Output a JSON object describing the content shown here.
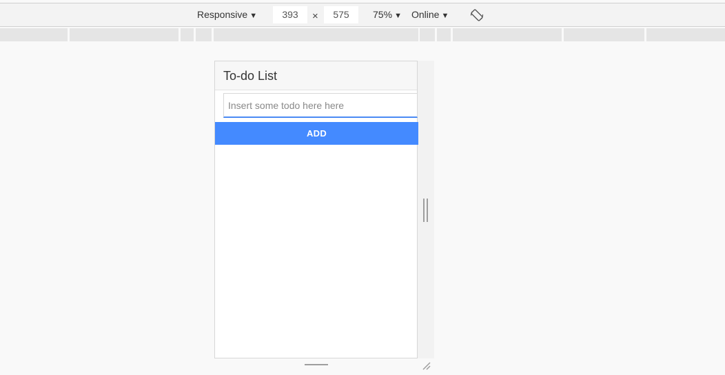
{
  "toolbar": {
    "device": "Responsive",
    "width": "393",
    "times": "×",
    "height": "575",
    "zoom": "75%",
    "network": "Online"
  },
  "app": {
    "title": "To-do List",
    "input_placeholder": "Insert some todo here here",
    "add_label": "ADD"
  },
  "colors": {
    "accent": "#448aff",
    "input_underline": "#4a8af4"
  },
  "icons": {
    "rotate": "rotate-icon",
    "dropdown": "dropdown-arrow-icon"
  }
}
